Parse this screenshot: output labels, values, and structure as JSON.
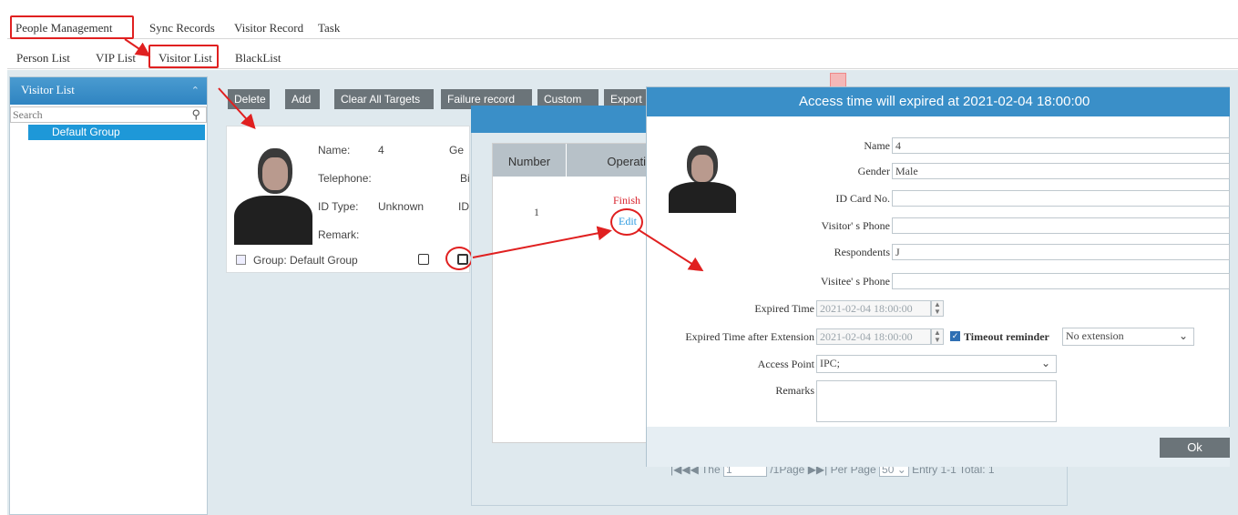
{
  "top_tabs": [
    "People Management",
    "Sync Records",
    "Visitor Record",
    "Task"
  ],
  "sub_tabs": [
    "Person List",
    "VIP List",
    "Visitor List",
    "BlackList"
  ],
  "sidebar": {
    "title": "Visitor List",
    "search_placeholder": "Search",
    "group": "Default Group"
  },
  "toolbar": [
    "Delete",
    "Add",
    "Clear All Targets",
    "Failure record",
    "Custom",
    "Export"
  ],
  "card": {
    "name_label": "Name:",
    "name_value": "4",
    "gender_label_partial": "Ge",
    "telephone_label": "Telephone:",
    "birth_label_partial": "Bi",
    "id_type_label": "ID Type:",
    "id_type_value": "Unknown",
    "id_label_partial": "ID",
    "remark_label": "Remark:",
    "group_text": "Group: Default Group"
  },
  "records_table": {
    "headers": [
      "Number",
      "Operatic"
    ],
    "rows": [
      {
        "number": "1",
        "status": "Finish",
        "action": "Edit"
      }
    ]
  },
  "pager": {
    "prefix": "The",
    "page": "1",
    "page_suffix": "/1Page",
    "per_page_label": "Per Page",
    "per_page": "50",
    "summary": "Entry 1-1 Total: 1"
  },
  "edit_dialog": {
    "title": "Access time will expired at 2021-02-04 18:00:00",
    "fields": {
      "name_label": "Name",
      "name_value": "4",
      "gender_label": "Gender",
      "gender_value": "Male",
      "id_card_label": "ID Card No.",
      "id_card_value": "",
      "visitor_phone_label": "Visitor' s Phone",
      "visitor_phone_value": "",
      "respondents_label": "Respondents",
      "respondents_value": "J",
      "visitee_phone_label": "Visitee' s Phone",
      "visitee_phone_value": "",
      "expired_time_label": "Expired Time",
      "expired_time_value": "2021-02-04 18:00:00",
      "expired_ext_label": "Expired Time after Extension",
      "expired_ext_value": "2021-02-04 18:00:00",
      "timeout_label": "Timeout reminder",
      "timeout_checked": true,
      "extension_value": "No extension",
      "access_point_label": "Access Point",
      "access_point_value": "IPC;",
      "remarks_label": "Remarks",
      "remarks_value": ""
    },
    "ok_label": "Ok"
  },
  "colors": {
    "accent": "#3a8fc8",
    "highlight_red": "#e02020",
    "button_gray": "#6b7479",
    "finish_red": "#d9262f",
    "edit_blue": "#2e9be0"
  }
}
